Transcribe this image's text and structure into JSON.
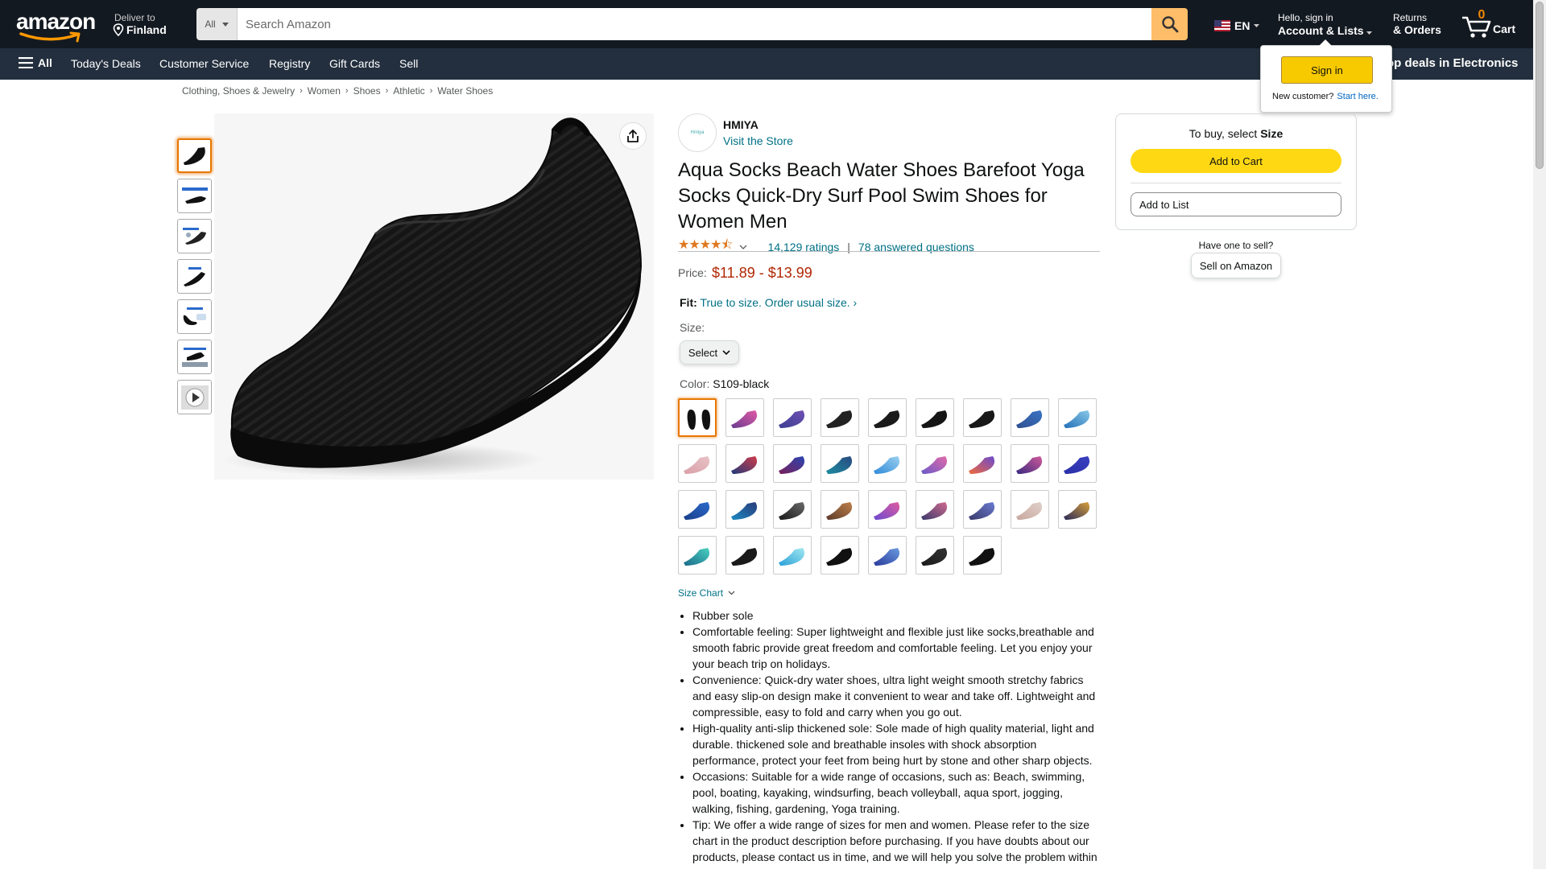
{
  "header": {
    "logo_text": "amazon",
    "deliver_line1": "Deliver to",
    "deliver_line2": "Finland",
    "search_category": "All",
    "search_placeholder": "Search Amazon",
    "lang": "EN",
    "account_line1": "Hello, sign in",
    "account_line2": "Account & Lists",
    "returns_line1": "Returns",
    "returns_line2": "& Orders",
    "cart_count": "0",
    "cart_label": "Cart"
  },
  "subnav": {
    "all_label": "All",
    "items": [
      "Today's Deals",
      "Customer Service",
      "Registry",
      "Gift Cards",
      "Sell"
    ],
    "promo": "op deals in Electronics"
  },
  "flyout": {
    "signin": "Sign in",
    "new_customer": "New customer?",
    "start_here": "Start here."
  },
  "breadcrumbs": [
    "Clothing, Shoes & Jewelry",
    "Women",
    "Shoes",
    "Athletic",
    "Water Shoes"
  ],
  "product": {
    "brand": "HMIYA",
    "logo_text": "Hmiya",
    "visit_store": "Visit the Store",
    "title": "Aqua Socks Beach Water Shoes Barefoot Yoga Socks Quick-Dry Surf Pool Swim Shoes for Women Men",
    "rating_stars": 4.5,
    "ratings_count": "14,129 ratings",
    "answered": "78 answered questions",
    "price_label": "Price:",
    "price": "$11.89 - $13.99",
    "fit_label": "Fit:",
    "fit_text": "True to size. Order usual size.",
    "size_label": "Size:",
    "size_value": "Select",
    "color_label": "Color:",
    "color_value": "S109-black",
    "size_chart": "Size Chart",
    "bullets": [
      "Rubber sole",
      "Comfortable feeling: Super lightweight and flexible just like socks,breathable and smooth fabric provide great freedom and comfortable feeling. Let you enjoy your your beach trip on holidays.",
      "Convenience: Quick-dry water shoes, ultra light weight smooth stretchy fabrics and easy slip-on design make it convenient to wear and take off. Lightweight and compressible, easy to fold and carry when you go out.",
      "High-quality anti-slip thickened sole: Sole made of high quality material, light and durable. thickened sole and breathable insoles with shock absorption performance, protect your feet from being hurt by stone and other sharp objects.",
      "Occasions: Suitable for a wide range of occasions, such as: Beach, swimming, pool, boating, kayaking, windsurfing, beach volleyball, aqua sport, jogging, walking, fishing, gardening, Yoga training.",
      "Tip: We offer a wide range of sizes for men and women. Please refer to the size chart in the product description before purchasing. If you have doubts about our products, please contact us in time, and we will help you solve the problem within"
    ]
  },
  "swatch_colors": [
    [
      "#111111",
      "#111111"
    ],
    [
      "#6a3d8f",
      "#e05aa6"
    ],
    [
      "#3b3f8f",
      "#6f4fb5"
    ],
    [
      "#222222",
      "#222222"
    ],
    [
      "#1a1a1a",
      "#1a1a1a"
    ],
    [
      "#151515",
      "#151515"
    ],
    [
      "#181818",
      "#181818"
    ],
    [
      "#2e4f8f",
      "#3a74c4"
    ],
    [
      "#2270b8",
      "#88c8e8"
    ],
    [
      "#d9a0a8",
      "#e8c2c6"
    ],
    [
      "#1f3a7a",
      "#d03b4a"
    ],
    [
      "#7a1f5a",
      "#2a46b0"
    ],
    [
      "#1c8ca0",
      "#2a4a80"
    ],
    [
      "#2f8ad8",
      "#9ad0f0"
    ],
    [
      "#6a5ac8",
      "#e26aa8"
    ],
    [
      "#f06a3a",
      "#6a4ad0"
    ],
    [
      "#3a2a80",
      "#d05a9a"
    ],
    [
      "#2a30a8",
      "#3a40c0"
    ],
    [
      "#1a3f8a",
      "#2a6acc"
    ],
    [
      "#1c8ac0",
      "#2a3a7a"
    ],
    [
      "#1a1a1a",
      "#6a6a6a"
    ],
    [
      "#5a3a2a",
      "#c0804a"
    ],
    [
      "#6a4ad0",
      "#e05aa0"
    ],
    [
      "#3a3a6a",
      "#d06a90"
    ],
    [
      "#3a3a6a",
      "#6a7ad0"
    ],
    [
      "#c8a8a0",
      "#e0d0c8"
    ],
    [
      "#2a2a5a",
      "#d8a03a"
    ],
    [
      "#1a6a8a",
      "#4ad0c0"
    ],
    [
      "#1a1a1a",
      "#1a1a1a"
    ],
    [
      "#2aa0d8",
      "#a0e8f0"
    ],
    [
      "#111111",
      "#111111"
    ],
    [
      "#2a3a9a",
      "#6a9ae0"
    ],
    [
      "#1a1a1a",
      "#333333"
    ],
    [
      "#111111",
      "#111111"
    ]
  ],
  "buybox": {
    "to_buy": "To buy, select",
    "to_buy_bold": "Size",
    "add_to_cart": "Add to Cart",
    "add_to_list": "Add to List",
    "have_one": "Have one to sell?",
    "sell_on": "Sell on Amazon"
  },
  "colors": {
    "nav_dark": "#131921",
    "subnav": "#232f3e",
    "accent_orange": "#febd69",
    "link": "#007185",
    "price_red": "#b12704",
    "cart_yellow": "#ffd814"
  }
}
